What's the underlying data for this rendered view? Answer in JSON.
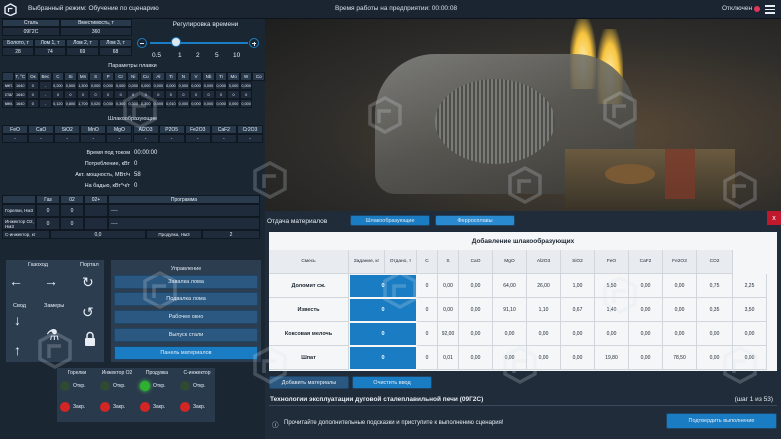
{
  "topbar": {
    "mode": "Выбранный режим: Обучение по сценарию",
    "time": "Время работы на предприятии: 00:00:08",
    "status": "Отключен"
  },
  "steel": {
    "h1": "Сталь",
    "h2": "Вместимость, т",
    "v1": "09Г2С",
    "v2": "360",
    "r1": [
      "Болото, т",
      "Лом 1, т",
      "Лом 2, т",
      "Лом 3, т"
    ],
    "r2": [
      "28",
      "74",
      "69",
      "68"
    ]
  },
  "time_reg": {
    "title": "Регулировка времени",
    "ticks": [
      "0.5",
      "1",
      "2",
      "5",
      "10"
    ]
  },
  "melt": {
    "title": "Параметры плавки",
    "headers": [
      "T, °C",
      "Ок",
      "Вес",
      "C",
      "Si",
      "Mn",
      "S",
      "P",
      "Cr",
      "Ni",
      "Cu",
      "Al",
      "Ti",
      "N",
      "V",
      "Nb",
      "Ti",
      "Mo",
      "W",
      "Co"
    ],
    "rows": [
      {
        "label": "мет.",
        "vals": [
          "1640",
          "0",
          "-",
          "0,200",
          "0,500",
          "1,300",
          "0,000",
          "0,000",
          "0,000",
          "0,000",
          "0,000",
          "0,000",
          "0,000",
          "0,000",
          "0,000",
          "0,000",
          "0,000",
          "0,000",
          "0,000"
        ]
      },
      {
        "label": "сталь",
        "vals": [
          "1640",
          "0",
          "-",
          "0",
          "0",
          "0",
          "0",
          "0",
          "0",
          "0",
          "0",
          "0",
          "0",
          "0",
          "0",
          "0",
          "0",
          "0",
          "0"
        ]
      },
      {
        "label": "мех.",
        "vals": [
          "1640",
          "0",
          "-",
          "0,120",
          "0,800",
          "1,700",
          "0,020",
          "0,030",
          "0,300",
          "0,300",
          "0,300",
          "0,005",
          "0,010",
          "0,000",
          "0,000",
          "0,000",
          "0,000",
          "0,000",
          "0,000"
        ]
      }
    ]
  },
  "slag": {
    "title": "Шлакообразующие",
    "headers": [
      "FeO",
      "CaO",
      "SiO2",
      "MnO",
      "MgO",
      "Al2O3",
      "P2O5",
      "Fe2O3",
      "CaF2",
      "Cr2O3"
    ],
    "vals": [
      "-",
      "-",
      "-",
      "-",
      "-",
      "-",
      "-",
      "-",
      "-",
      "-"
    ]
  },
  "power": [
    {
      "label": "Время под током",
      "val": "00:00:00"
    },
    {
      "label": "Потребление, кВт",
      "val": "0"
    },
    {
      "label": "Акт. мощность, МВт/ч",
      "val": "58"
    },
    {
      "label": "На бадью, кВт*ч/т",
      "val": "0"
    }
  ],
  "gas": {
    "h": [
      "Газ",
      "02",
      "02+",
      "Программа"
    ],
    "rows": [
      {
        "label": "Горелки, Нм3",
        "a": "0",
        "b": "0",
        "c": "----"
      },
      {
        "label": "Инжектор О2, Нм3",
        "a": "0",
        "b": "0",
        "c": "----"
      }
    ],
    "last": {
      "l1": "С-инжектор, кг",
      "v1": "0,0",
      "l2": "Продувка, Нм3",
      "v2": "2"
    }
  },
  "controls": {
    "gas_title": "Газоход",
    "portal": "Портал",
    "vault": "Свод",
    "windows": "Замеры",
    "mgmt": "Управление",
    "buttons": [
      "Завалка лома",
      "Подвалка лома",
      "Рабочее окно",
      "Выпуск стали",
      "Панель материалов"
    ]
  },
  "lamps": {
    "cols": [
      "Горелки",
      "Инжектор О2",
      "Продувка",
      "С-инжектор"
    ],
    "on": "Откр.",
    "off": "Закр."
  },
  "materials": {
    "title": "Отдача материалов",
    "tab1": "Шлакообразующие",
    "tab2": "Ферросплавы",
    "close": "x",
    "table_title": "Добавление шлакообразующих",
    "headers": [
      "Смесь",
      "Задание, кг",
      "Отдано, т",
      "C",
      "S",
      "CaO",
      "MgO",
      "Al2O3",
      "SiO2",
      "FeO",
      "CaF2",
      "Fe2O3",
      "CO2"
    ],
    "rows": [
      {
        "name": "Доломит сж.",
        "task": "0",
        "given": "0",
        "vals": [
          "0,00",
          "0,00",
          "64,00",
          "26,00",
          "1,00",
          "5,50",
          "0,00",
          "0,00",
          "0,75",
          "2,25"
        ]
      },
      {
        "name": "Известь",
        "task": "0",
        "given": "0",
        "vals": [
          "0,00",
          "0,00",
          "91,10",
          "1,10",
          "0,67",
          "1,40",
          "0,00",
          "0,00",
          "0,35",
          "3,50"
        ]
      },
      {
        "name": "Коксовая мелочь",
        "task": "0",
        "given": "0",
        "vals": [
          "92,00",
          "0,00",
          "0,00",
          "0,00",
          "0,00",
          "0,00",
          "0,00",
          "0,00",
          "0,00",
          "0,00"
        ]
      },
      {
        "name": "Шпат",
        "task": "0",
        "given": "0",
        "vals": [
          "0,01",
          "0,00",
          "0,00",
          "0,00",
          "0,00",
          "19,80",
          "0,00",
          "78,50",
          "0,00",
          "0,00"
        ]
      }
    ],
    "add_btn": "Добавить материалы",
    "clear_btn": "Очистить ввод"
  },
  "tech": {
    "title": "Технологии эксплуатации дуговой сталеплавильной печи (09Г2С)",
    "step": "(шаг 1 из 53)",
    "hint": "Прочитайте дополнительные подсказки и приступите к выполнению сценария!",
    "confirm": "Подтвердить выполнение"
  },
  "colors": {
    "accent": "#1a7cc2",
    "green": "#2fb12f",
    "red": "#d42525",
    "close": "#c0182c"
  }
}
